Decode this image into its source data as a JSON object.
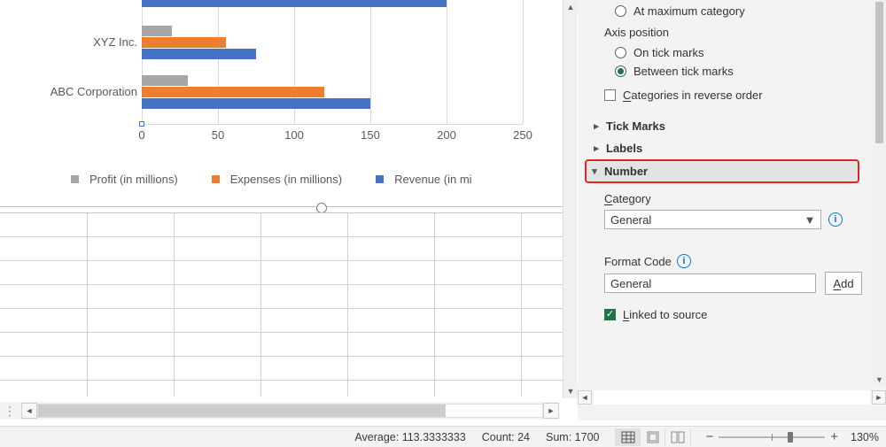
{
  "chart_data": {
    "type": "bar",
    "orientation": "horizontal",
    "categories": [
      "ABC Corporation",
      "XYZ Inc."
    ],
    "series": [
      {
        "name": "Profit (in millions)",
        "values": [
          30,
          20
        ],
        "color": "#a6a6a6"
      },
      {
        "name": "Expenses (in millions)",
        "values": [
          120,
          55
        ],
        "color": "#ed7d31"
      },
      {
        "name": "Revenue (in millions)",
        "values": [
          150,
          75
        ],
        "color": "#4472c4"
      }
    ],
    "xlabel": "",
    "ylabel": "",
    "x_ticks": [
      "0",
      "50",
      "100",
      "150",
      "200",
      "250"
    ],
    "partial_top_series_revenue_value": 200,
    "legend_position": "bottom"
  },
  "legend": {
    "profit": "Profit (in millions)",
    "expenses": "Expenses (in millions)",
    "revenue_truncated": "Revenue (in mi"
  },
  "side": {
    "radio_at_max": "At maximum category",
    "axis_position_label": "Axis position",
    "radio_on_tick": "On tick marks",
    "radio_between": "Between tick marks",
    "check_reverse_prefix": "C",
    "check_reverse_rest": "ategories in reverse order",
    "section_tick_marks": "Tick Marks",
    "section_labels": "Labels",
    "section_number": "Number",
    "category_label_prefix": "C",
    "category_label_rest": "ategory",
    "category_value": "General",
    "format_code_label": "Format Code",
    "format_code_value": "General",
    "add_btn_prefix": "A",
    "add_btn_rest": "dd",
    "linked_prefix": "L",
    "linked_rest": "inked to source"
  },
  "status": {
    "average_label": "Average:",
    "average_value": "113.3333333",
    "count_label": "Count:",
    "count_value": "24",
    "sum_label": "Sum:",
    "sum_value": "1700",
    "zoom_pct": "130%"
  }
}
